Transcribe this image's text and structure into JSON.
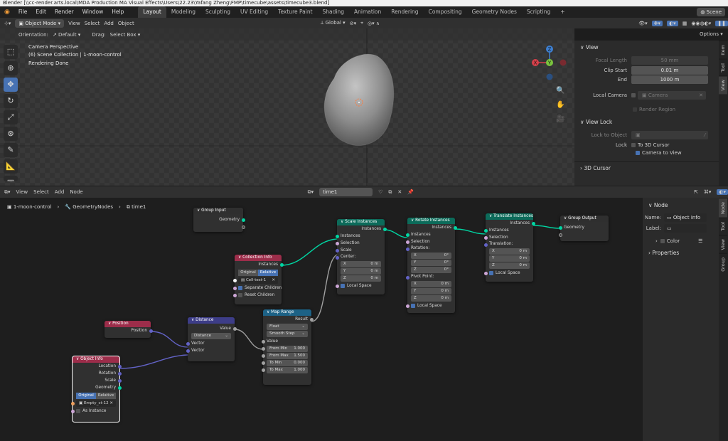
{
  "titlebar": "Blender  [\\\\cc-render.arts.local\\MDA Production MA Visual Effects\\Users\\22.23\\Yafang Zheng\\FMP\\timecube\\assets\\timecube3.blend]",
  "menu": [
    "File",
    "Edit",
    "Render",
    "Window",
    "Help"
  ],
  "workspaces": [
    "Layout",
    "Modeling",
    "Sculpting",
    "UV Editing",
    "Texture Paint",
    "Shading",
    "Animation",
    "Rendering",
    "Compositing",
    "Geometry Nodes",
    "Scripting"
  ],
  "active_workspace": "Layout",
  "scene_label": "Scene",
  "viewport_header": {
    "mode": "Object Mode",
    "menus": [
      "View",
      "Select",
      "Add",
      "Object"
    ],
    "transform_orientation": "Global",
    "options_label": "Options",
    "orientation_label": "Orientation:",
    "orientation_value": "Default",
    "drag_label": "Drag:",
    "drag_value": "Select Box"
  },
  "viewport_info": {
    "line1": "Camera Perspective",
    "line2": "(6) Scene Collection | 1-moon-control",
    "line3": "Rendering Done"
  },
  "gizmo": {
    "x": "X",
    "y": "Y",
    "z": "Z"
  },
  "npanel": {
    "view_title": "View",
    "focal_length_label": "Focal Length",
    "focal_length_value": "50 mm",
    "clip_start_label": "Clip Start",
    "clip_start_value": "0.01 m",
    "end_label": "End",
    "end_value": "1000 m",
    "local_camera_label": "Local Camera",
    "camera_value": "Camera",
    "render_region_label": "Render Region",
    "view_lock_title": "View Lock",
    "lock_to_object_label": "Lock to Object",
    "lock_label": "Lock",
    "to_3d_cursor": "To 3D Cursor",
    "camera_to_view": "Camera to View",
    "cursor_title": "3D Cursor",
    "tabs": [
      "Item",
      "Tool",
      "View"
    ]
  },
  "node_header": {
    "menus": [
      "View",
      "Select",
      "Add",
      "Node"
    ],
    "tree_name": "time1"
  },
  "breadcrumb": [
    "1-moon-control",
    "GeometryNodes",
    "time1"
  ],
  "nodes": {
    "group_input": {
      "title": "Group Input",
      "out": "Geometry"
    },
    "collection_info": {
      "title": "Collection Info",
      "out": "Instances",
      "btn1": "Original",
      "btn2": "Relative",
      "collection": "Cell-test-1",
      "sep": "Separate Children",
      "reset": "Reset Children"
    },
    "scale_instances": {
      "title": "Scale Instances",
      "out": "Instances",
      "in1": "Instances",
      "in2": "Selection",
      "in3": "Scale",
      "center": "Center:",
      "x": "X",
      "y": "Y",
      "z": "Z",
      "xv": "0 m",
      "yv": "0 m",
      "zv": "0 m",
      "local": "Local Space"
    },
    "rotate_instances": {
      "title": "Rotate Instances",
      "out": "Instances",
      "in1": "Instances",
      "in2": "Selection",
      "rotation": "Rotation:",
      "x": "X",
      "y": "Y",
      "z": "Z",
      "rx": "0°",
      "ry": "0°",
      "rz": "0°",
      "pivot": "Pivot Point:",
      "px": "0 m",
      "py": "0 m",
      "pz": "0 m",
      "local": "Local Space"
    },
    "translate_instances": {
      "title": "Translate Instances",
      "out": "Instances",
      "in1": "Instances",
      "in2": "Selection",
      "translation": "Translation:",
      "x": "X",
      "y": "Y",
      "z": "Z",
      "tx": "0 m",
      "ty": "0 m",
      "tz": "0 m",
      "local": "Local Space"
    },
    "group_output": {
      "title": "Group Output",
      "in": "Geometry"
    },
    "position": {
      "title": "Position",
      "out": "Position"
    },
    "distance": {
      "title": "Distance",
      "out": "Value",
      "mode": "Distance",
      "in1": "Vector",
      "in2": "Vector"
    },
    "map_range": {
      "title": "Map Range",
      "out": "Result",
      "type": "Float",
      "interp": "Smooth Step",
      "value": "Value",
      "from_min_l": "From Min",
      "from_min": "1.000",
      "from_max_l": "From Max",
      "from_max": "1.500",
      "to_min_l": "To Min",
      "to_min": "0.000",
      "to_max_l": "To Max",
      "to_max": "1.000"
    },
    "object_info": {
      "title": "Object Info",
      "o1": "Location",
      "o2": "Rotation",
      "o3": "Scale",
      "o4": "Geometry",
      "btn1": "Original",
      "btn2": "Relative",
      "object": "Empty_ct-12",
      "as_instance": "As Instance"
    }
  },
  "node_side": {
    "title": "Node",
    "name_label": "Name:",
    "name_value": "Object Info",
    "label_label": "Label:",
    "color_label": "Color",
    "properties_label": "Properties",
    "tabs": [
      "Node",
      "Tool",
      "View",
      "Group"
    ]
  }
}
